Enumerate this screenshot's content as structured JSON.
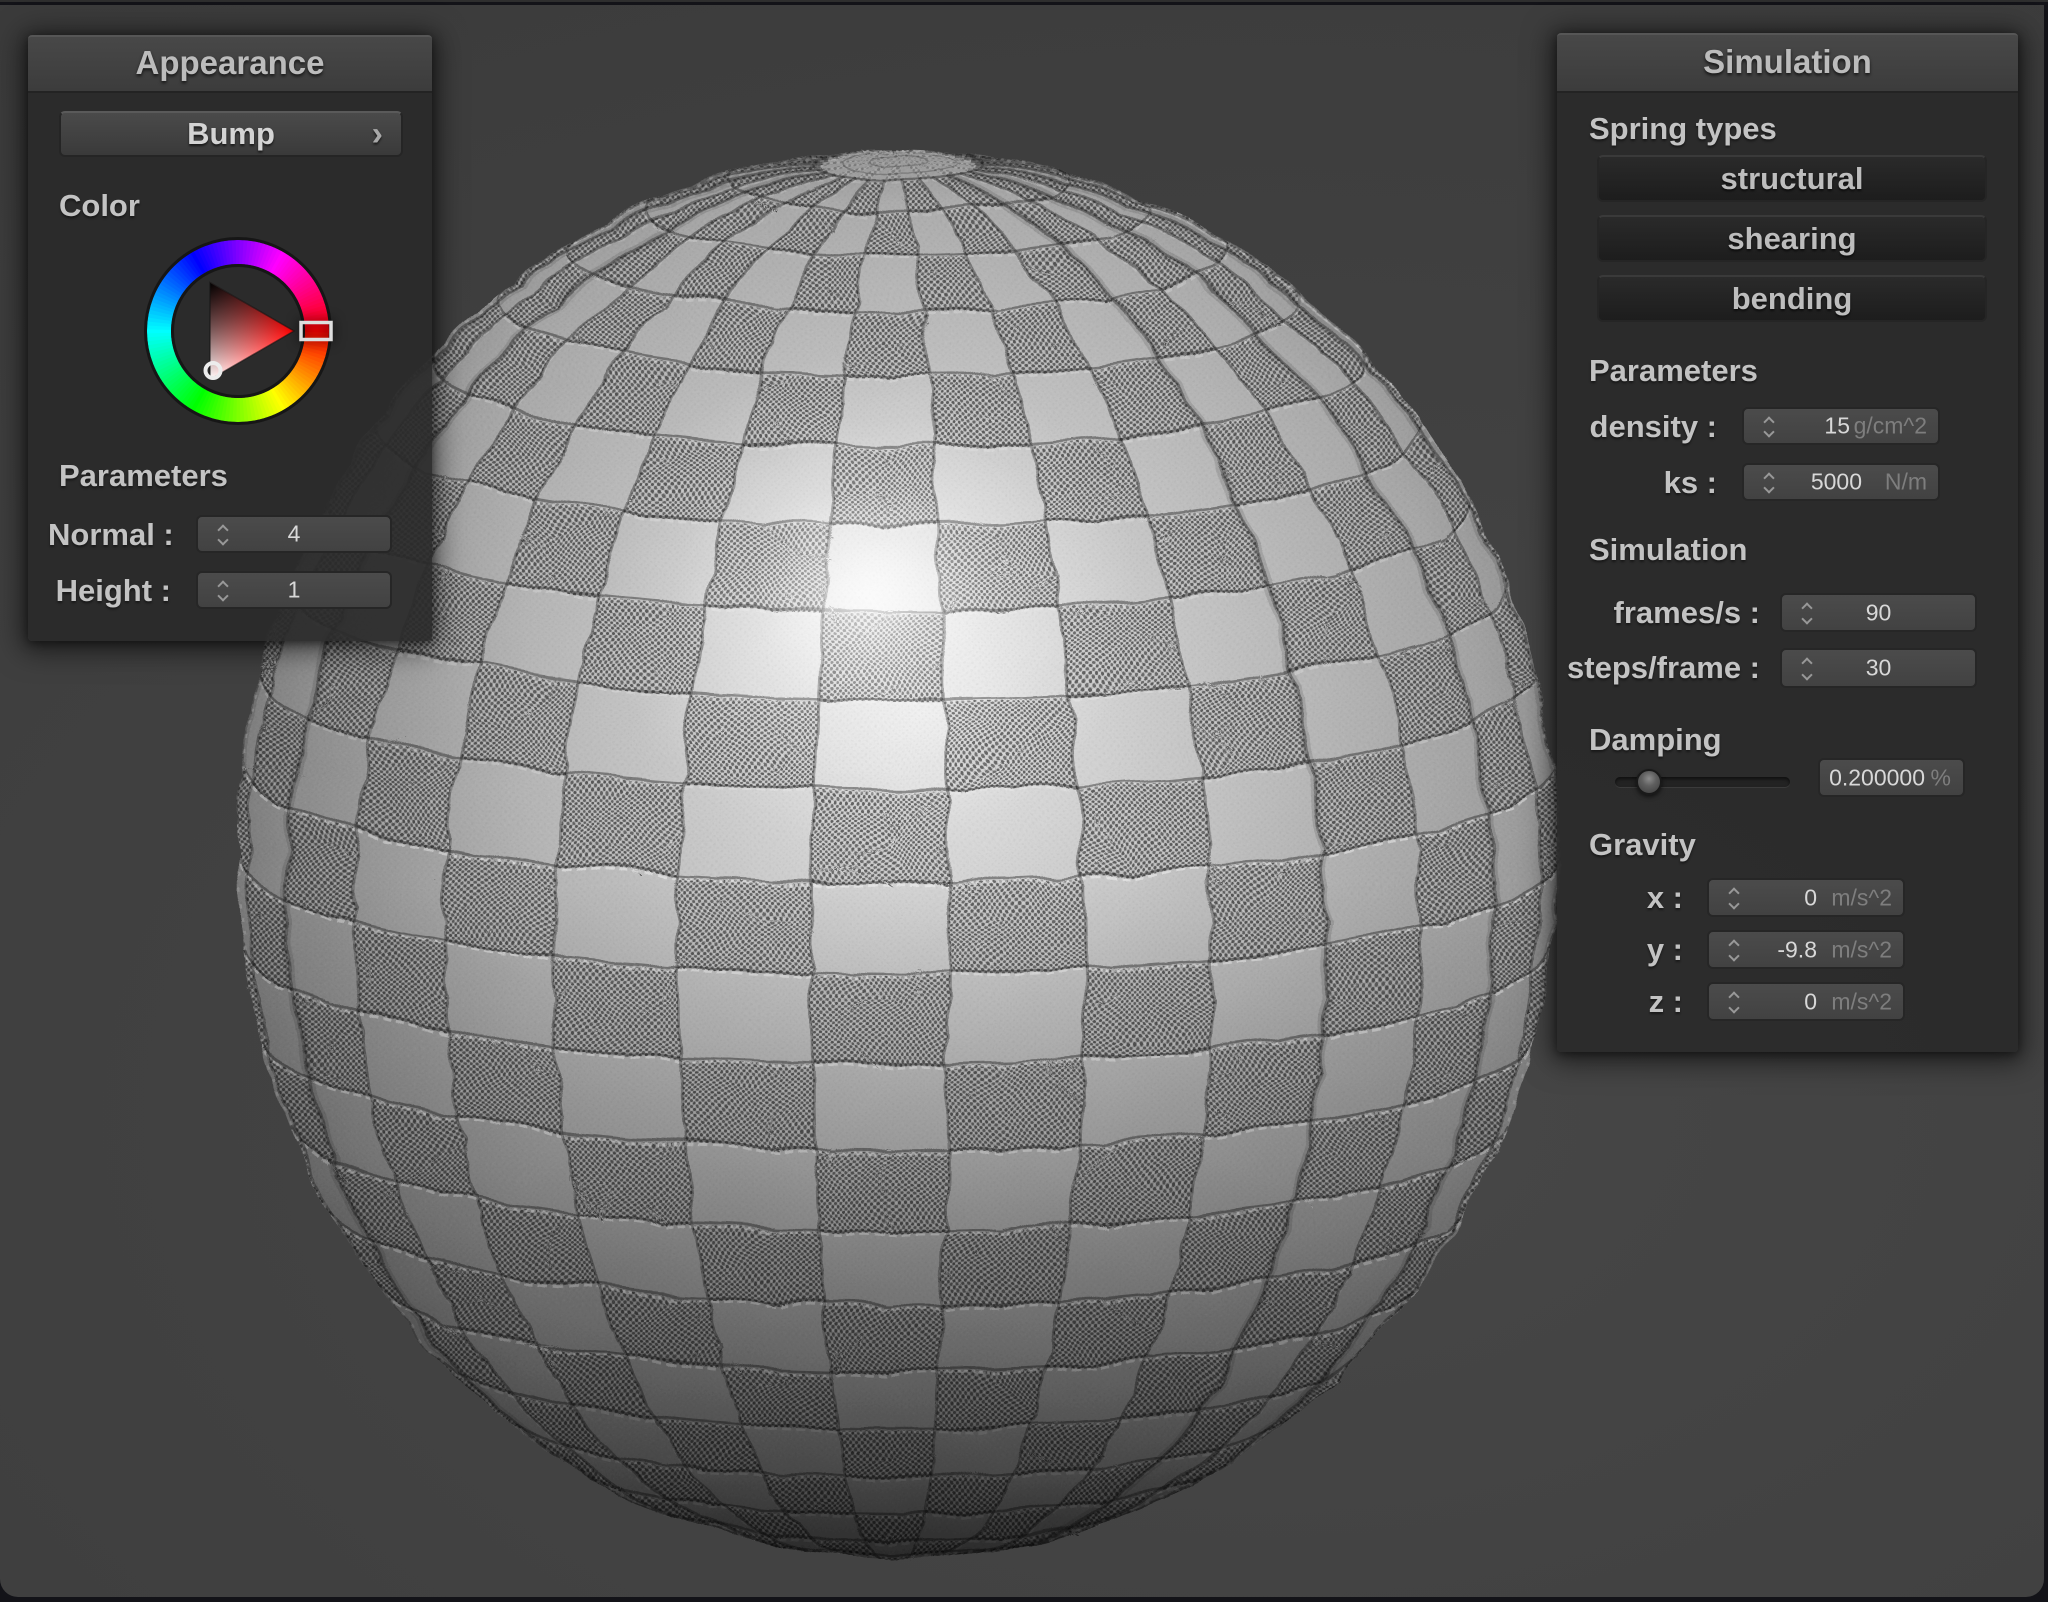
{
  "colors": {
    "viewport_background": "#3f3f3f",
    "panel_fill": "#2b2b2b",
    "header_gradient_top": "#484848",
    "header_gradient_bottom": "#3c3c3c",
    "label_text": "#c3c3c3",
    "value_text": "#d8d8d8",
    "unit_text": "#7e7e7e",
    "selected_hue": "#ff0000",
    "sphere_highlight": "#ffffff"
  },
  "appearance_panel": {
    "title": "Appearance",
    "bump_button": {
      "label": "Bump",
      "chevron": "›"
    },
    "color_label": "Color",
    "parameters_label": "Parameters",
    "normal_row": {
      "label": "Normal :",
      "value": "4"
    },
    "height_row": {
      "label": "Height :",
      "value": "1"
    },
    "color_wheel": {
      "selected_hue": "red",
      "marker": "white-corner"
    }
  },
  "simulation_panel": {
    "title": "Simulation",
    "spring_types_label": "Spring types",
    "spring_buttons": [
      {
        "label": "structural"
      },
      {
        "label": "shearing"
      },
      {
        "label": "bending"
      }
    ],
    "parameters_label": "Parameters",
    "density_row": {
      "label": "density :",
      "value": "15",
      "unit": "g/cm^2"
    },
    "ks_row": {
      "label": "ks :",
      "value": "5000",
      "unit": "N/m"
    },
    "simulation_label": "Simulation",
    "frames_row": {
      "label": "frames/s :",
      "value": "90"
    },
    "steps_row": {
      "label": "steps/frame :",
      "value": "30"
    },
    "damping_label": "Damping",
    "damping": {
      "value": "0.200000",
      "unit": "%",
      "fraction": 0.2
    },
    "gravity_label": "Gravity",
    "gravity_x_row": {
      "label": "x :",
      "value": "0",
      "unit": "m/s^2"
    },
    "gravity_y_row": {
      "label": "y :",
      "value": "-9.8",
      "unit": "m/s^2"
    },
    "gravity_z_row": {
      "label": "z :",
      "value": "0",
      "unit": "m/s^2"
    }
  }
}
